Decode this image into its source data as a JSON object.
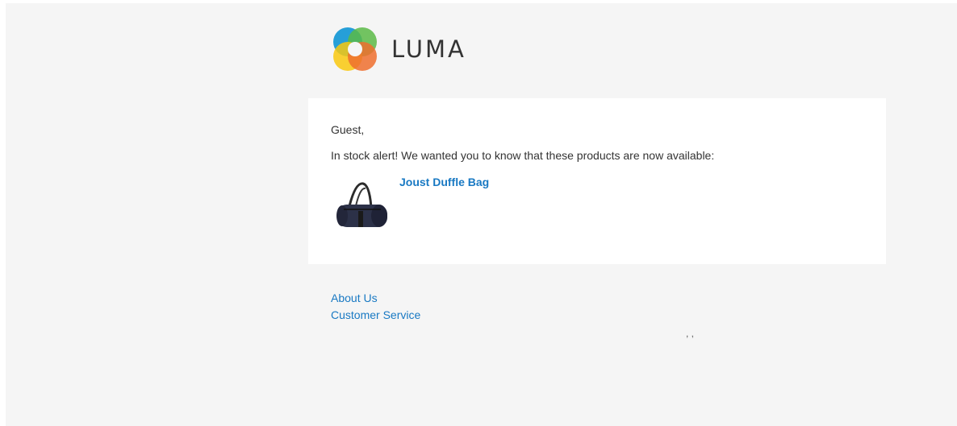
{
  "header": {
    "logo_text": "LUMA"
  },
  "email": {
    "greeting": "Guest,",
    "intro": "In stock alert! We wanted you to know that these products are now available:",
    "products": [
      {
        "name": "Joust Duffle Bag",
        "image_icon": "duffle-bag-icon"
      }
    ]
  },
  "footer": {
    "links": [
      "About Us",
      "Customer Service"
    ],
    "address": ", ,"
  },
  "colors": {
    "page_background": "#f5f5f5",
    "content_background": "#ffffff",
    "link": "#1979c3",
    "text": "#333333",
    "logo_blue": "#1a9ad6",
    "logo_green": "#5bba47",
    "logo_yellow": "#f9c80e",
    "logo_orange": "#ef6f2e"
  }
}
